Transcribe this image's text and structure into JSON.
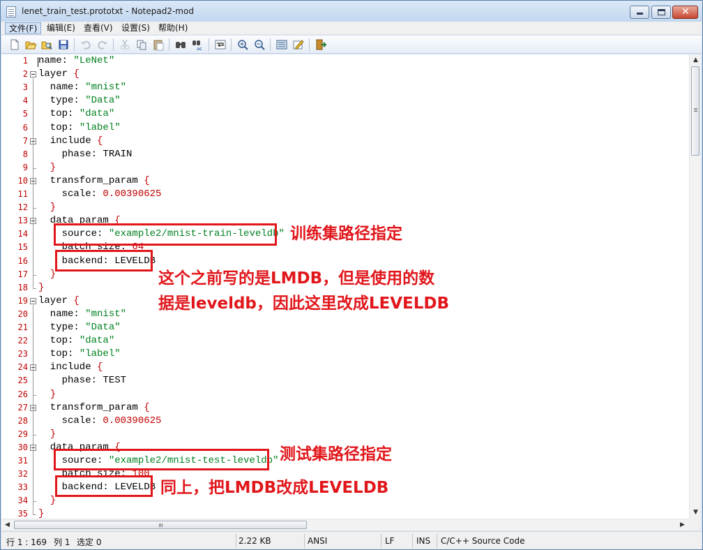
{
  "window": {
    "title": "lenet_train_test.prototxt - Notepad2-mod"
  },
  "menu": [
    {
      "label": "文件(F)"
    },
    {
      "label": "编辑(E)"
    },
    {
      "label": "查看(V)"
    },
    {
      "label": "设置(S)"
    },
    {
      "label": "帮助(H)"
    }
  ],
  "toolbar_icons": [
    "new-file-icon",
    "open-folder-icon",
    "browse-icon",
    "save-icon",
    "undo-icon",
    "redo-icon",
    "cut-icon",
    "copy-icon",
    "paste-icon",
    "find-icon",
    "replace-icon",
    "word-wrap-icon",
    "zoom-in-icon",
    "zoom-out-icon",
    "scheme-icon",
    "customize-icon",
    "exit-icon"
  ],
  "editor": {
    "lines": [
      {
        "n": "1",
        "parts": [
          [
            "",
            "name: "
          ],
          [
            "str",
            "\"LeNet\""
          ]
        ]
      },
      {
        "n": "2",
        "parts": [
          [
            "",
            "layer "
          ],
          [
            "brace",
            "{"
          ]
        ]
      },
      {
        "n": "3",
        "parts": [
          [
            "",
            "  name: "
          ],
          [
            "str",
            "\"mnist\""
          ]
        ]
      },
      {
        "n": "4",
        "parts": [
          [
            "",
            "  type: "
          ],
          [
            "str",
            "\"Data\""
          ]
        ]
      },
      {
        "n": "5",
        "parts": [
          [
            "",
            "  top: "
          ],
          [
            "str",
            "\"data\""
          ]
        ]
      },
      {
        "n": "6",
        "parts": [
          [
            "",
            "  top: "
          ],
          [
            "str",
            "\"label\""
          ]
        ]
      },
      {
        "n": "7",
        "parts": [
          [
            "",
            "  include "
          ],
          [
            "brace",
            "{"
          ]
        ]
      },
      {
        "n": "8",
        "parts": [
          [
            "",
            "    phase: TRAIN"
          ]
        ]
      },
      {
        "n": "9",
        "parts": [
          [
            "brace",
            "  }"
          ]
        ]
      },
      {
        "n": "10",
        "parts": [
          [
            "",
            "  transform_param "
          ],
          [
            "brace",
            "{"
          ]
        ]
      },
      {
        "n": "11",
        "parts": [
          [
            "",
            "    scale: "
          ],
          [
            "num",
            "0.00390625"
          ]
        ]
      },
      {
        "n": "12",
        "parts": [
          [
            "brace",
            "  }"
          ]
        ]
      },
      {
        "n": "13",
        "parts": [
          [
            "",
            "  data_param "
          ],
          [
            "brace",
            "{"
          ]
        ]
      },
      {
        "n": "14",
        "parts": [
          [
            "",
            "    source: "
          ],
          [
            "str",
            "\"example2/mnist-train-leveldb\""
          ]
        ]
      },
      {
        "n": "15",
        "parts": [
          [
            "",
            "    batch_size: "
          ],
          [
            "num",
            "64"
          ]
        ]
      },
      {
        "n": "16",
        "parts": [
          [
            "",
            "    backend: LEVELDB"
          ]
        ]
      },
      {
        "n": "17",
        "parts": [
          [
            "brace",
            "  }"
          ]
        ]
      },
      {
        "n": "18",
        "parts": [
          [
            "brace",
            "}"
          ]
        ]
      },
      {
        "n": "19",
        "parts": [
          [
            "",
            "layer "
          ],
          [
            "brace",
            "{"
          ]
        ]
      },
      {
        "n": "20",
        "parts": [
          [
            "",
            "  name: "
          ],
          [
            "str",
            "\"mnist\""
          ]
        ]
      },
      {
        "n": "21",
        "parts": [
          [
            "",
            "  type: "
          ],
          [
            "str",
            "\"Data\""
          ]
        ]
      },
      {
        "n": "22",
        "parts": [
          [
            "",
            "  top: "
          ],
          [
            "str",
            "\"data\""
          ]
        ]
      },
      {
        "n": "23",
        "parts": [
          [
            "",
            "  top: "
          ],
          [
            "str",
            "\"label\""
          ]
        ]
      },
      {
        "n": "24",
        "parts": [
          [
            "",
            "  include "
          ],
          [
            "brace",
            "{"
          ]
        ]
      },
      {
        "n": "25",
        "parts": [
          [
            "",
            "    phase: TEST"
          ]
        ]
      },
      {
        "n": "26",
        "parts": [
          [
            "brace",
            "  }"
          ]
        ]
      },
      {
        "n": "27",
        "parts": [
          [
            "",
            "  transform_param "
          ],
          [
            "brace",
            "{"
          ]
        ]
      },
      {
        "n": "28",
        "parts": [
          [
            "",
            "    scale: "
          ],
          [
            "num",
            "0.00390625"
          ]
        ]
      },
      {
        "n": "29",
        "parts": [
          [
            "brace",
            "  }"
          ]
        ]
      },
      {
        "n": "30",
        "parts": [
          [
            "",
            "  data_param "
          ],
          [
            "brace",
            "{"
          ]
        ]
      },
      {
        "n": "31",
        "parts": [
          [
            "",
            "    source: "
          ],
          [
            "str",
            "\"example2/mnist-test-leveldb\""
          ]
        ]
      },
      {
        "n": "32",
        "parts": [
          [
            "",
            "    batch_size: "
          ],
          [
            "num",
            "100"
          ]
        ]
      },
      {
        "n": "33",
        "parts": [
          [
            "",
            "    backend: LEVELDB"
          ]
        ]
      },
      {
        "n": "34",
        "parts": [
          [
            "brace",
            "  }"
          ]
        ]
      },
      {
        "n": "35",
        "parts": [
          [
            "brace",
            "}"
          ]
        ]
      }
    ]
  },
  "annotations": {
    "train_source": "训练集路径指定",
    "backend_note_line1": "这个之前写的是LMDB，但是使用的数",
    "backend_note_line2": "据是leveldb，因此这里改成LEVELDB",
    "test_source": "测试集路径指定",
    "same_as_above": "同上，把LMDB改成LEVELDB"
  },
  "statusbar": {
    "position": "行 1 : 169",
    "column": "列 1",
    "selection": "选定 0",
    "size": "2.22 KB",
    "encoding": "ANSI",
    "line_ending": "LF",
    "mode": "INS",
    "scheme": "C/C++ Source Code"
  }
}
